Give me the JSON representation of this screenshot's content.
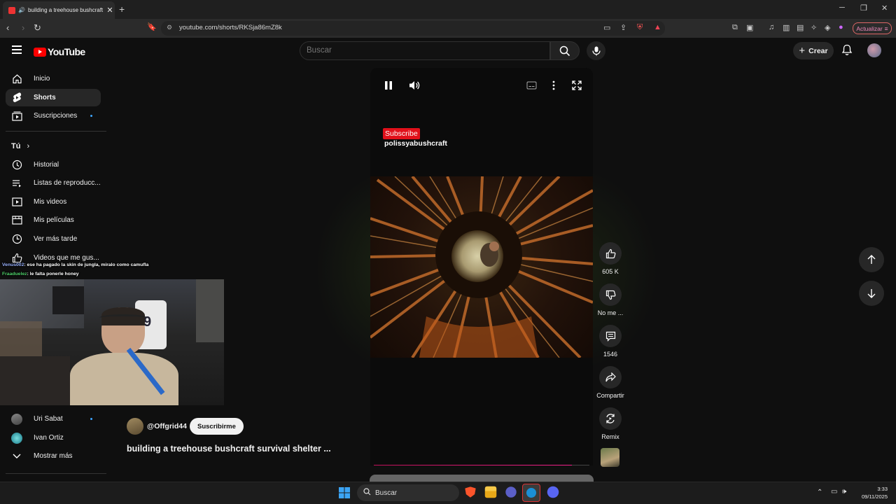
{
  "browser": {
    "tab_title": "building a treehouse bushcraft",
    "url": "youtube.com/shorts/RKSja86mZ8k",
    "update_label": "Actualizar"
  },
  "header": {
    "logo_text": "YouTube",
    "search_placeholder": "Buscar",
    "create_label": "Crear"
  },
  "sidebar": {
    "main": [
      {
        "label": "Inicio",
        "icon": "home-icon"
      },
      {
        "label": "Shorts",
        "icon": "shorts-icon"
      },
      {
        "label": "Suscripciones",
        "icon": "subscriptions-icon"
      }
    ],
    "you_heading": "Tú",
    "you": [
      {
        "label": "Historial",
        "icon": "history-icon"
      },
      {
        "label": "Listas de reproducc...",
        "icon": "playlists-icon"
      },
      {
        "label": "Mis videos",
        "icon": "my-videos-icon"
      },
      {
        "label": "Mis películas",
        "icon": "movies-icon"
      },
      {
        "label": "Ver más tarde",
        "icon": "watch-later-icon"
      },
      {
        "label": "Videos que me gus...",
        "icon": "liked-videos-icon"
      }
    ],
    "subscriptions": [
      {
        "label": "Uri Sabat"
      },
      {
        "label": "Ivan Ortiz"
      }
    ],
    "show_more": "Mostrar más"
  },
  "chat": [
    {
      "user": "Venus002",
      "message": ": ese ha pagado la skin de jungla, miralo como camufla"
    },
    {
      "user": "Fraaduelez",
      "message": ": le falta ponerle honey"
    }
  ],
  "player": {
    "subscribe_overlay": "Subscribe",
    "channel_overlay": "polissyabushcraft",
    "progress": 0.92
  },
  "actions": {
    "likes": "605 K",
    "dislike_label": "No me ...",
    "comments": "1546",
    "share_label": "Compartir",
    "remix_label": "Remix"
  },
  "short": {
    "handle": "@Offgrid44",
    "subscribe_label": "Suscribirme",
    "title": "building a treehouse bushcraft survival shelter ..."
  },
  "taskbar": {
    "search_label": "Buscar",
    "time": "3:33",
    "date": "09/11/2025"
  }
}
